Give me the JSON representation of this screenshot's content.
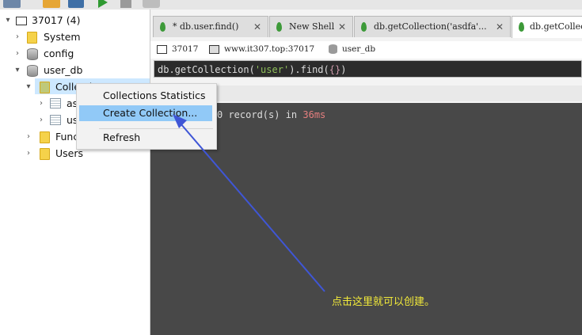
{
  "tree": {
    "root": "37017 (4)",
    "system": "System",
    "config": "config",
    "user_db": "user_db",
    "collections": "Collections",
    "coll1": "asdfa",
    "coll2": "user",
    "functions": "Functions",
    "users": "Users"
  },
  "context_menu": {
    "items": [
      "Collections Statistics",
      "Create Collection...",
      "Refresh"
    ],
    "highlighted": "Create Collection..."
  },
  "tabs": [
    {
      "label": "* db.user.find()",
      "active": false
    },
    {
      "label": "New Shell",
      "active": false
    },
    {
      "label": "db.getCollection('asdfa'...",
      "active": false
    },
    {
      "label": "db.getCollection",
      "active": true
    }
  ],
  "info": {
    "port": "37017",
    "host": "www.it307.top:37017",
    "db": "user_db"
  },
  "query": {
    "prefix": "db.getCollection(",
    "arg": "'user'",
    "suffix": ").find(",
    "braces": "{}",
    "end": ")"
  },
  "result_text": {
    "pre": "0 record(s) in ",
    "time": "36ms"
  },
  "annotation": "点击这里就可以创建。",
  "colors": {
    "console_bg": "#484848",
    "annotation": "#f2ea3a",
    "arrow": "#3f56d6",
    "menu_highlight": "#91c9f7"
  }
}
